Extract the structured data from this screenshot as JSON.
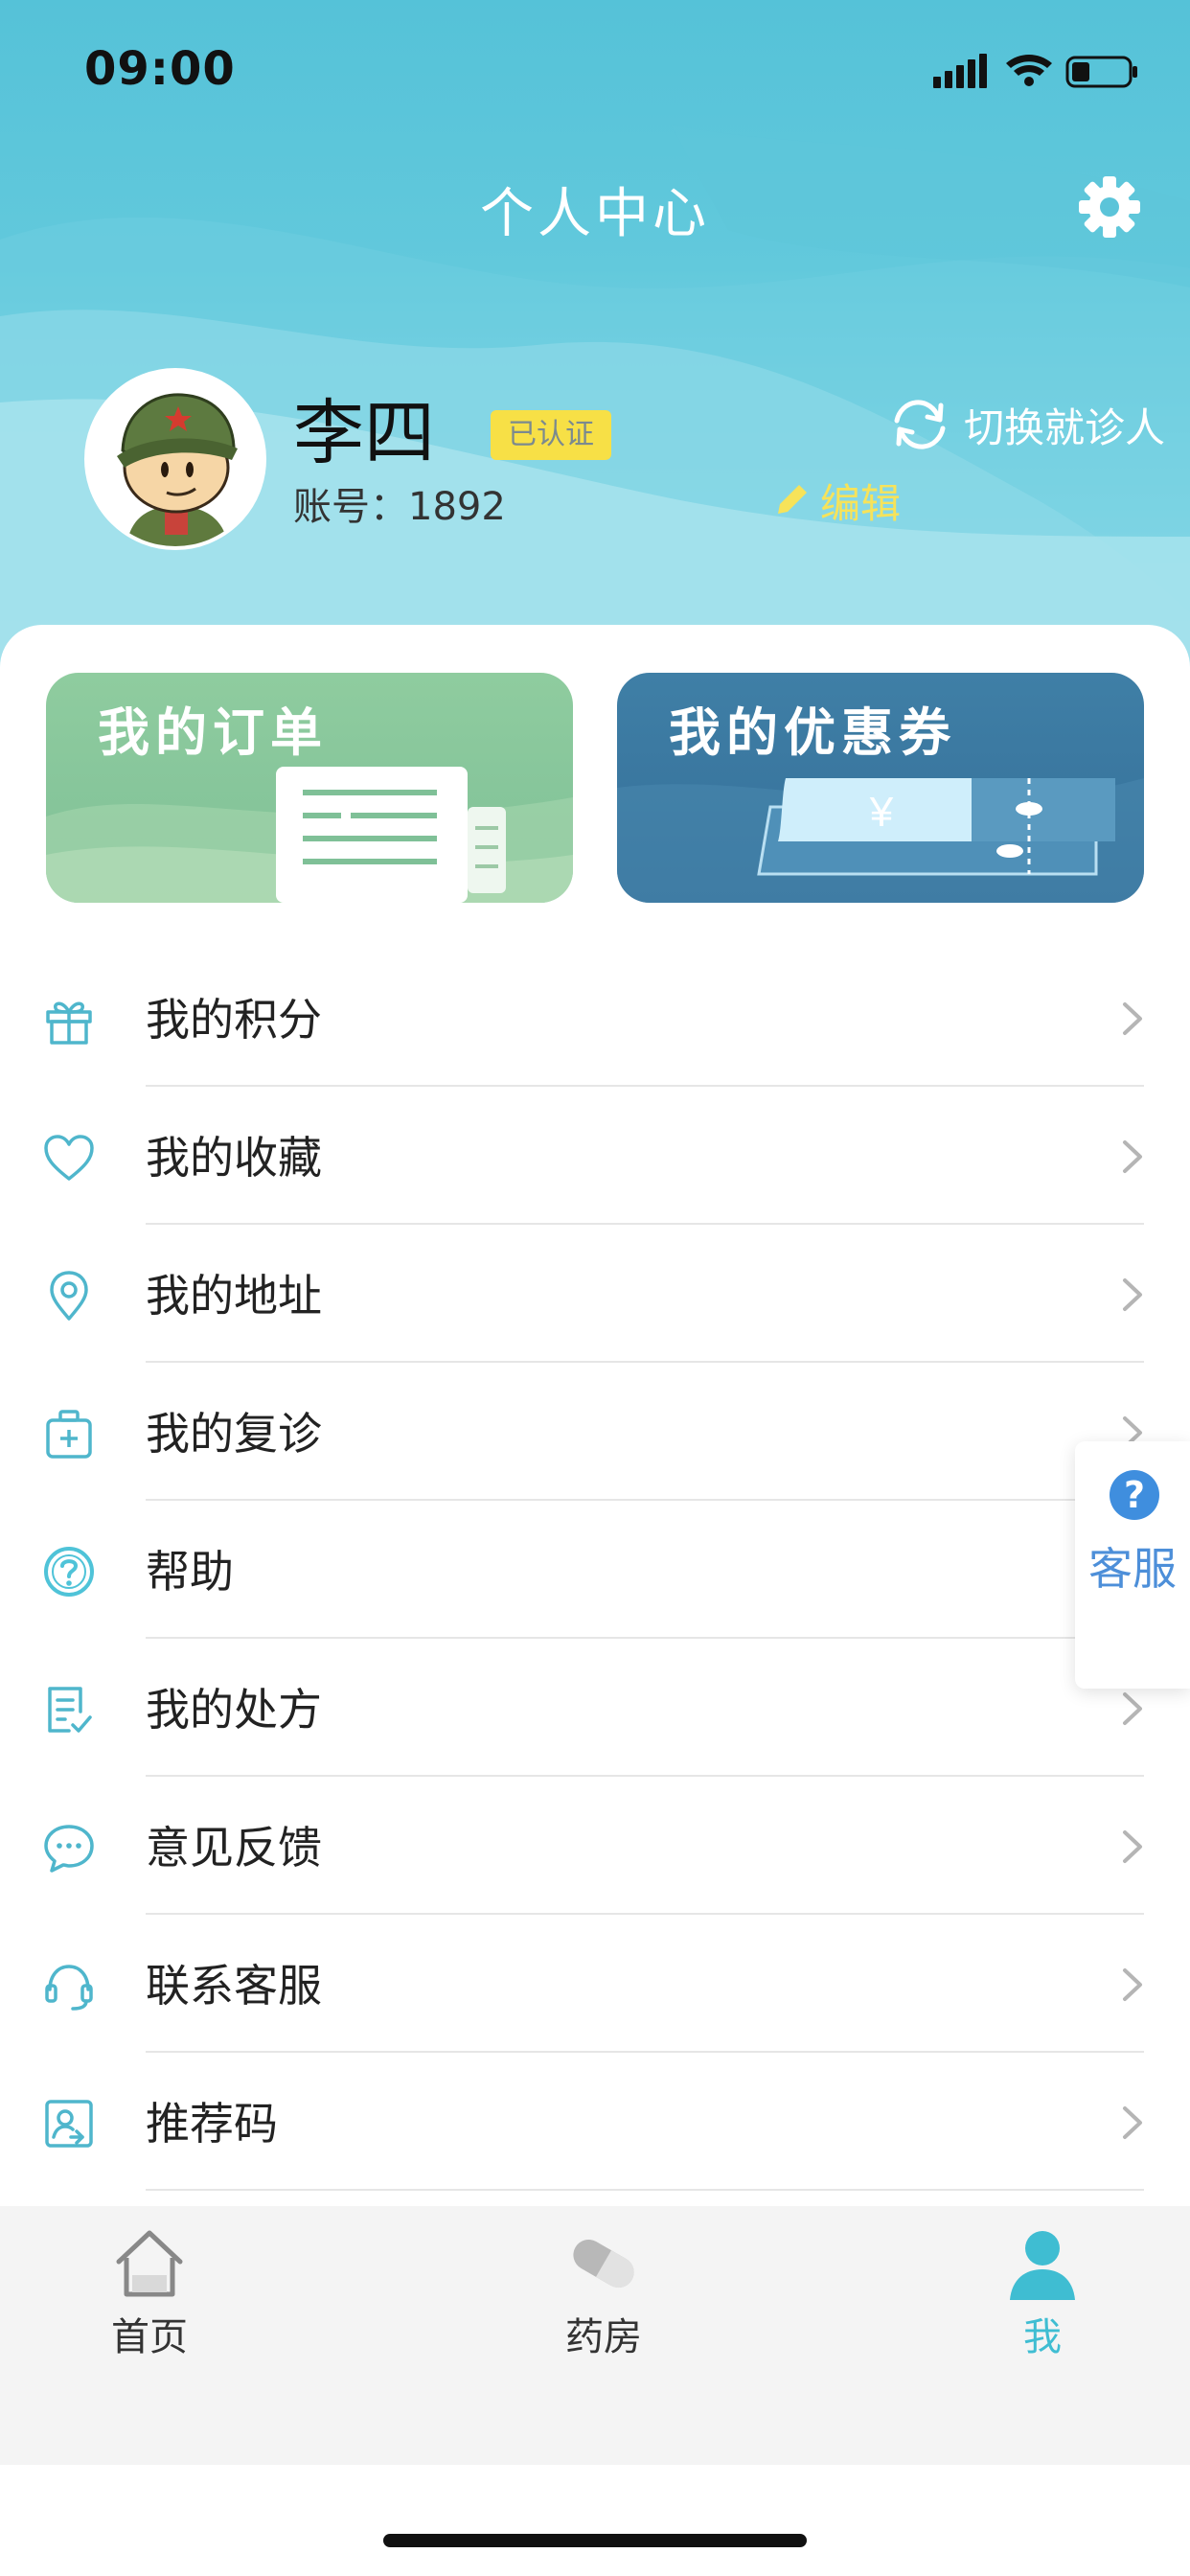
{
  "status_bar": {
    "time": "09:00"
  },
  "header": {
    "title": "个人中心",
    "user": {
      "name": "李四",
      "verified_label": "已认证",
      "account_label": "账号：",
      "account_number": "1892"
    },
    "switch_patient_label": "切换就诊人",
    "edit_label": "编辑"
  },
  "promos": {
    "orders_title": "我的订单",
    "coupons_title": "我的优惠券",
    "coupon_symbol": "¥"
  },
  "menu": {
    "items": [
      {
        "label": "我的积分",
        "icon": "gift-icon"
      },
      {
        "label": "我的收藏",
        "icon": "heart-icon"
      },
      {
        "label": "我的地址",
        "icon": "location-pin-icon"
      },
      {
        "label": "我的复诊",
        "icon": "medical-kit-icon"
      },
      {
        "label": "帮助",
        "icon": "help-circle-icon"
      },
      {
        "label": "我的处方",
        "icon": "prescription-icon"
      },
      {
        "label": "意见反馈",
        "icon": "chat-bubble-icon"
      },
      {
        "label": "联系客服",
        "icon": "headset-icon"
      },
      {
        "label": "推荐码",
        "icon": "referral-user-icon"
      }
    ]
  },
  "floating_service": {
    "symbol": "?",
    "label": "客服"
  },
  "tabbar": {
    "tabs": [
      {
        "label": "首页",
        "icon": "home-icon",
        "active": false
      },
      {
        "label": "药房",
        "icon": "pill-icon",
        "active": false
      },
      {
        "label": "我",
        "icon": "user-icon",
        "active": true
      }
    ]
  },
  "colors": {
    "header_teal": "#55c2d8",
    "accent_teal": "#3fbdd2",
    "verified_yellow": "#f7e046",
    "edit_yellow": "#f6e35a",
    "orders_green": "#8fcc9f",
    "coupons_blue": "#3f7fa6",
    "service_blue": "#4d8fd9"
  }
}
